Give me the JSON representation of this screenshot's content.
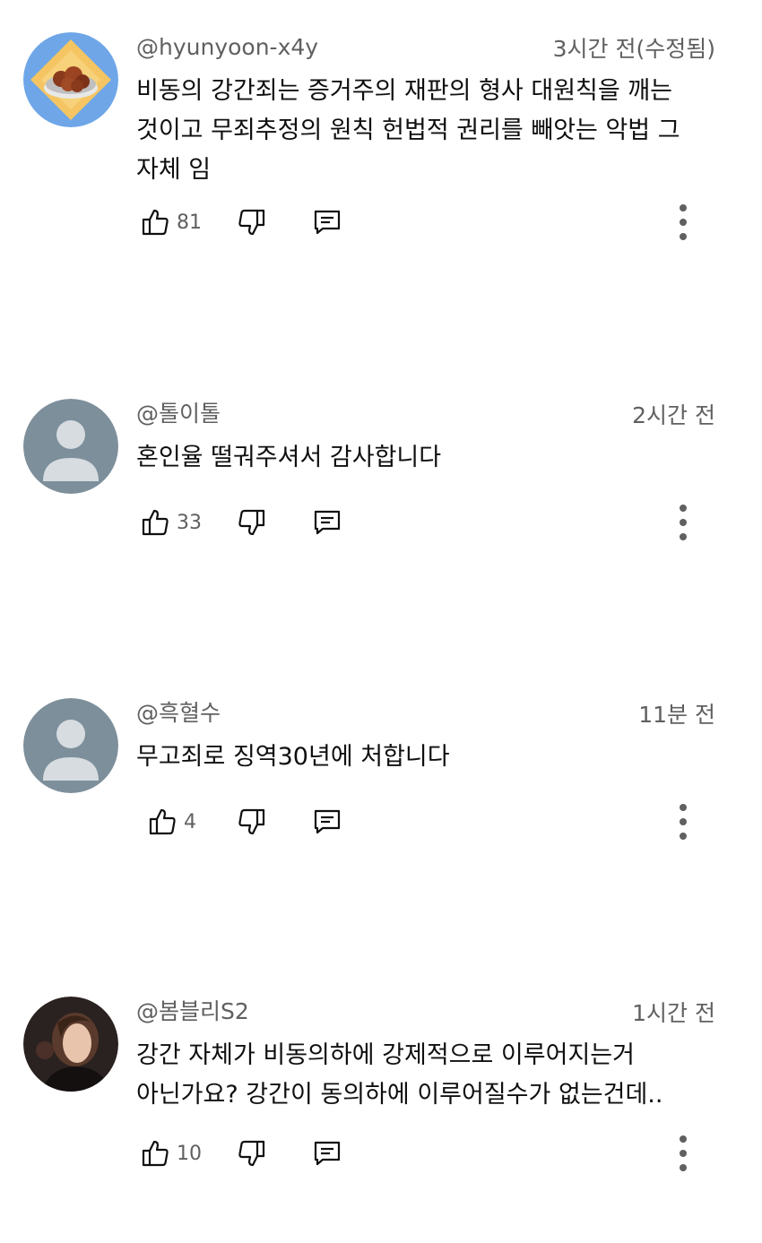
{
  "comments": [
    {
      "author": "@hyunyoon-x4y",
      "time": "3시간 전(수정됨)",
      "text": "비동의 강간죄는 증거주의 재판의 형사 대원칙을 깨는 것이고 무죄추정의 원칙 헌법적 권리를 빼앗는 악법 그 자체 임",
      "likes": "81",
      "avatar": "food-bowl-avatar"
    },
    {
      "author": "@톨이톨",
      "time": "2시간 전",
      "text": "혼인율 떨궈주셔서 감사합니다",
      "likes": "33",
      "avatar": "default-avatar"
    },
    {
      "author": "@흑혈수",
      "time": "11분 전",
      "text": "무고죄로 징역30년에 처합니다",
      "likes": "4",
      "avatar": "default-avatar"
    },
    {
      "author": "@봄블리S2",
      "time": "1시간 전",
      "text": "강간 자체가 비동의하에 강제적으로 이루어지는거 아닌가요? 강간이 동의하에 이루어질수가 없는건데..",
      "likes": "10",
      "avatar": "photo-avatar"
    }
  ],
  "icons": {
    "like": "thumbs-up-icon",
    "dislike": "thumbs-down-icon",
    "reply": "reply-comment-icon",
    "more": "more-vertical-icon"
  },
  "colors": {
    "text": "#0f0f0f",
    "secondary": "#606060",
    "default_avatar_bg": "#7d8f9b",
    "avatar_blue": "#6ea6e8",
    "avatar_yellow": "#f4c562"
  }
}
